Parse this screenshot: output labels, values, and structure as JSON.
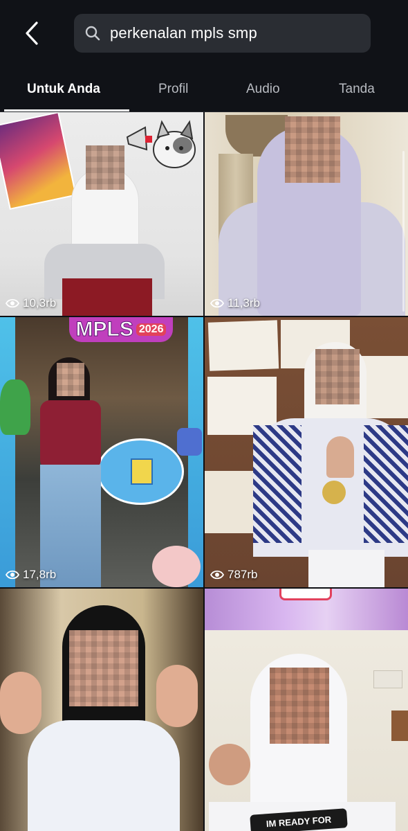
{
  "header": {
    "search_query": "perkenalan mpls smp"
  },
  "tabs": [
    {
      "label": "Untuk Anda",
      "active": true
    },
    {
      "label": "Profil",
      "active": false
    },
    {
      "label": "Audio",
      "active": false
    },
    {
      "label": "Tanda",
      "active": false
    }
  ],
  "videos": [
    {
      "views": "10,3rb"
    },
    {
      "views": "11,3rb"
    },
    {
      "views": "17,8rb",
      "banner": "MPLS",
      "banner_year": "2026"
    },
    {
      "views": "787rb"
    },
    {},
    {
      "overlay_text": "IM READY FOR"
    }
  ],
  "colors": {
    "background": "#0e0f13",
    "search_bg": "#2a2d33",
    "active_tab": "#ffffff",
    "inactive_tab": "#b8bbc1"
  }
}
